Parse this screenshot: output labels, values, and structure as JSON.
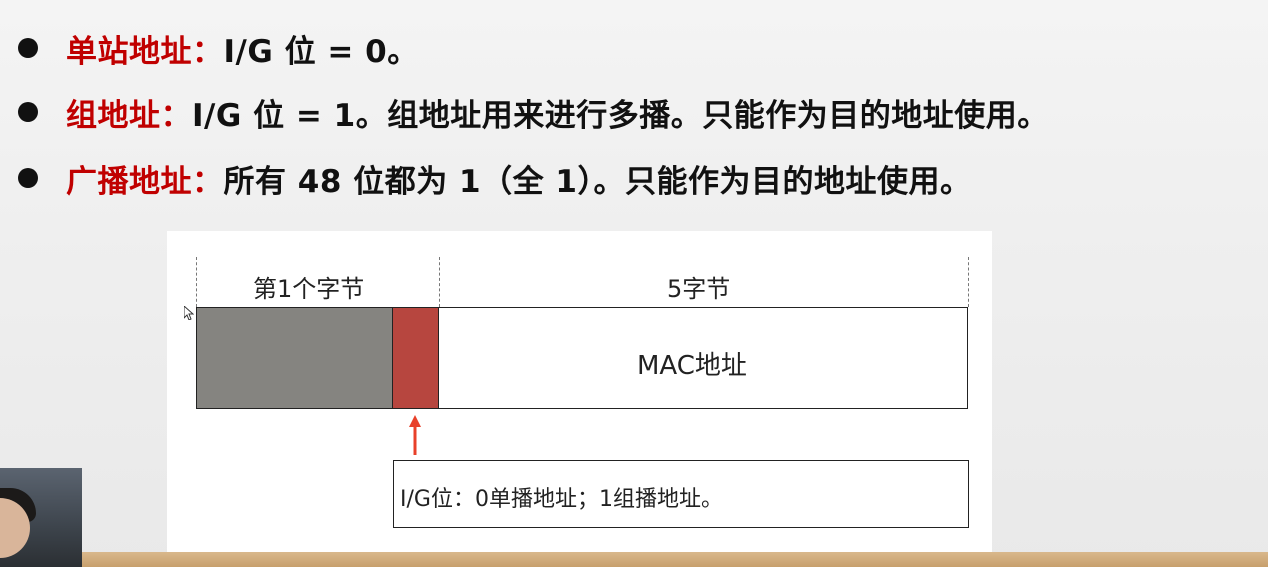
{
  "slide": {
    "bullets": [
      {
        "term": "单站地址",
        "colon": "：",
        "text": "I/G 位 = 0。"
      },
      {
        "term": "组地址",
        "colon": "：",
        "text": "I/G 位 = 1。组地址用来进行多播。只能作为目的地址使用。"
      },
      {
        "term": "广播地址",
        "colon": "：",
        "text": "所有 48 位都为 1（全 1）。只能作为目的地址使用。"
      }
    ],
    "term_color": "#c00000"
  },
  "diagram": {
    "first_byte_label": "第1个字节",
    "five_bytes_label": "5字节",
    "mac_label": "MAC地址",
    "note": "I/G位：0单播地址；1组播地址。",
    "colors": {
      "first_byte": "#858480",
      "ig_bit": "#b7463f",
      "arrow": "#e8402a"
    }
  }
}
